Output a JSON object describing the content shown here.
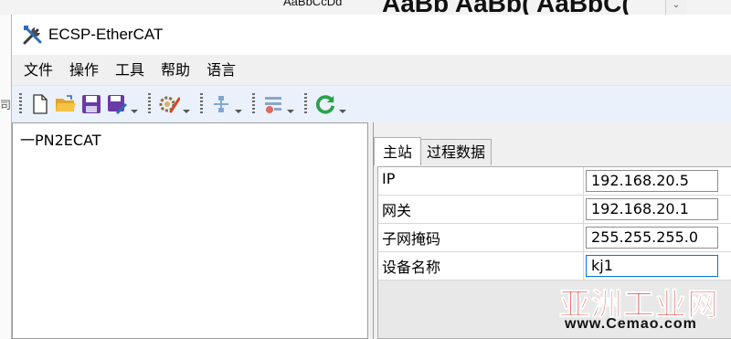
{
  "background_app": {
    "style_preview_small": "AaBbCcDd",
    "style_preview_large": "AaBb AaBb( AaBbC(",
    "scroll_glyph": "⌄",
    "left_edge_char": "司"
  },
  "window": {
    "title": "ECSP-EtherCAT",
    "icon": "tools-icon"
  },
  "menu": {
    "items": [
      {
        "label": "文件"
      },
      {
        "label": "操作"
      },
      {
        "label": "工具"
      },
      {
        "label": "帮助"
      },
      {
        "label": "语言"
      }
    ]
  },
  "toolbar": {
    "buttons": [
      "new-file-icon",
      "open-folder-icon",
      "save-icon",
      "save-as-icon",
      "settings-icon",
      "network-icon",
      "list-remove-icon",
      "refresh-icon"
    ]
  },
  "tree": {
    "root_label": "一PN2ECAT"
  },
  "tabs": [
    {
      "label": "主站",
      "active": true
    },
    {
      "label": "过程数据",
      "active": false
    }
  ],
  "properties": [
    {
      "label": "IP",
      "value": "192.168.20.5"
    },
    {
      "label": "网关",
      "value": "192.168.20.1"
    },
    {
      "label": "子网掩码",
      "value": "255.255.255.0"
    },
    {
      "label": "设备名称",
      "value": "kj1"
    }
  ],
  "watermark": {
    "main": "亚洲工业网",
    "sub": "www.Cemao.com"
  },
  "colors": {
    "toolbar_bg": "#eaf1fa",
    "accent": "#0078d7",
    "watermark_red": "#e01010"
  }
}
